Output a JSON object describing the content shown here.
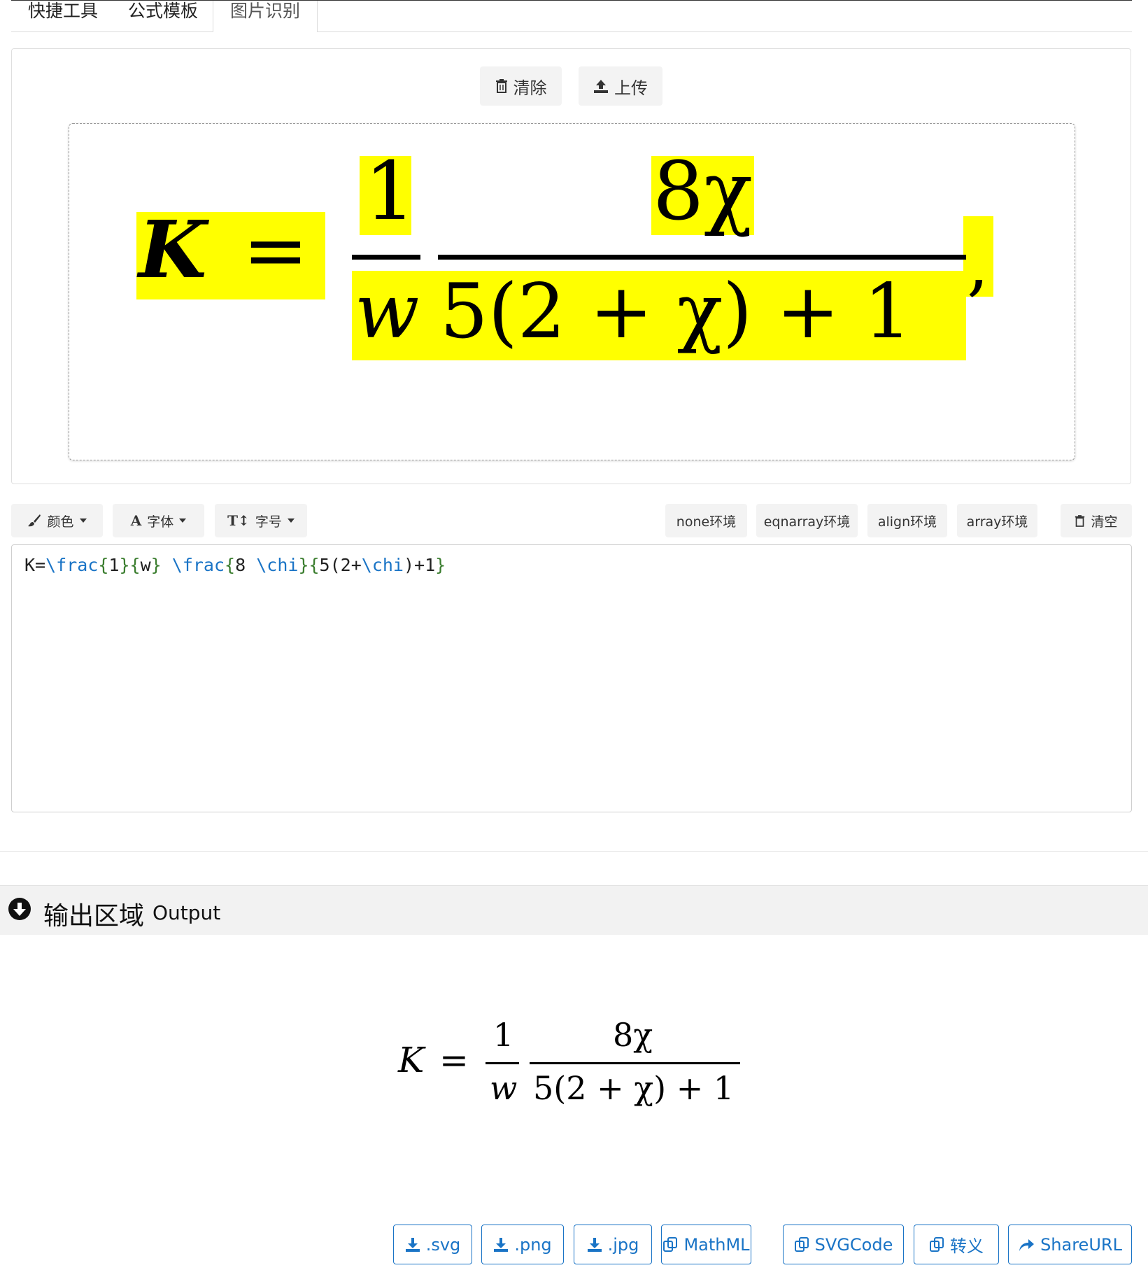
{
  "tabs": [
    {
      "label": "快捷工具"
    },
    {
      "label": "公式模板"
    },
    {
      "label": "图片识别"
    }
  ],
  "recognition": {
    "clear_label": "清除",
    "upload_label": "上传",
    "image_formula": {
      "K": "K",
      "eq": "=",
      "num1": "1",
      "den1": "w",
      "num2": "8χ",
      "den2": "5(2 + χ) + 1",
      "comma": ","
    }
  },
  "toolbar": {
    "color_label": "颜色",
    "font_label": "字体",
    "size_label": "字号",
    "env_none": "none环境",
    "env_eqnarray": "eqnarray环境",
    "env_align": "align环境",
    "env_array": "array环境",
    "clear_all_label": "清空"
  },
  "editor": {
    "tokens": [
      {
        "t": "K=",
        "c": "text"
      },
      {
        "t": "\\frac",
        "c": "cmd"
      },
      {
        "t": "{",
        "c": "brace"
      },
      {
        "t": "1",
        "c": "text"
      },
      {
        "t": "}{",
        "c": "brace"
      },
      {
        "t": "w",
        "c": "text"
      },
      {
        "t": "} ",
        "c": "brace"
      },
      {
        "t": "\\frac",
        "c": "cmd"
      },
      {
        "t": "{",
        "c": "brace"
      },
      {
        "t": "8 ",
        "c": "text"
      },
      {
        "t": "\\chi",
        "c": "cmd"
      },
      {
        "t": "}{",
        "c": "brace"
      },
      {
        "t": "5(2+",
        "c": "text"
      },
      {
        "t": "\\chi",
        "c": "cmd"
      },
      {
        "t": ")+1",
        "c": "text"
      },
      {
        "t": "}",
        "c": "brace"
      }
    ]
  },
  "output": {
    "title": "输出区域",
    "subtitle": "Output",
    "formula": {
      "K": "K",
      "eq": "=",
      "num1": "1",
      "den1": "w",
      "num2": "8χ",
      "den2": "5(2 + χ) + 1"
    },
    "buttons": [
      {
        "label": ".svg",
        "icon": "download-icon"
      },
      {
        "label": ".png",
        "icon": "download-icon"
      },
      {
        "label": ".jpg",
        "icon": "download-icon"
      },
      {
        "label": "MathML",
        "icon": "copy-icon"
      },
      {
        "label": "SVGCode",
        "icon": "copy-icon"
      },
      {
        "label": "转义",
        "icon": "copy-icon"
      },
      {
        "label": "ShareURL",
        "icon": "share-icon"
      }
    ]
  },
  "colors": {
    "highlight": "#ffff00",
    "accent": "#1a74c6",
    "brace": "#3a7d2e"
  }
}
